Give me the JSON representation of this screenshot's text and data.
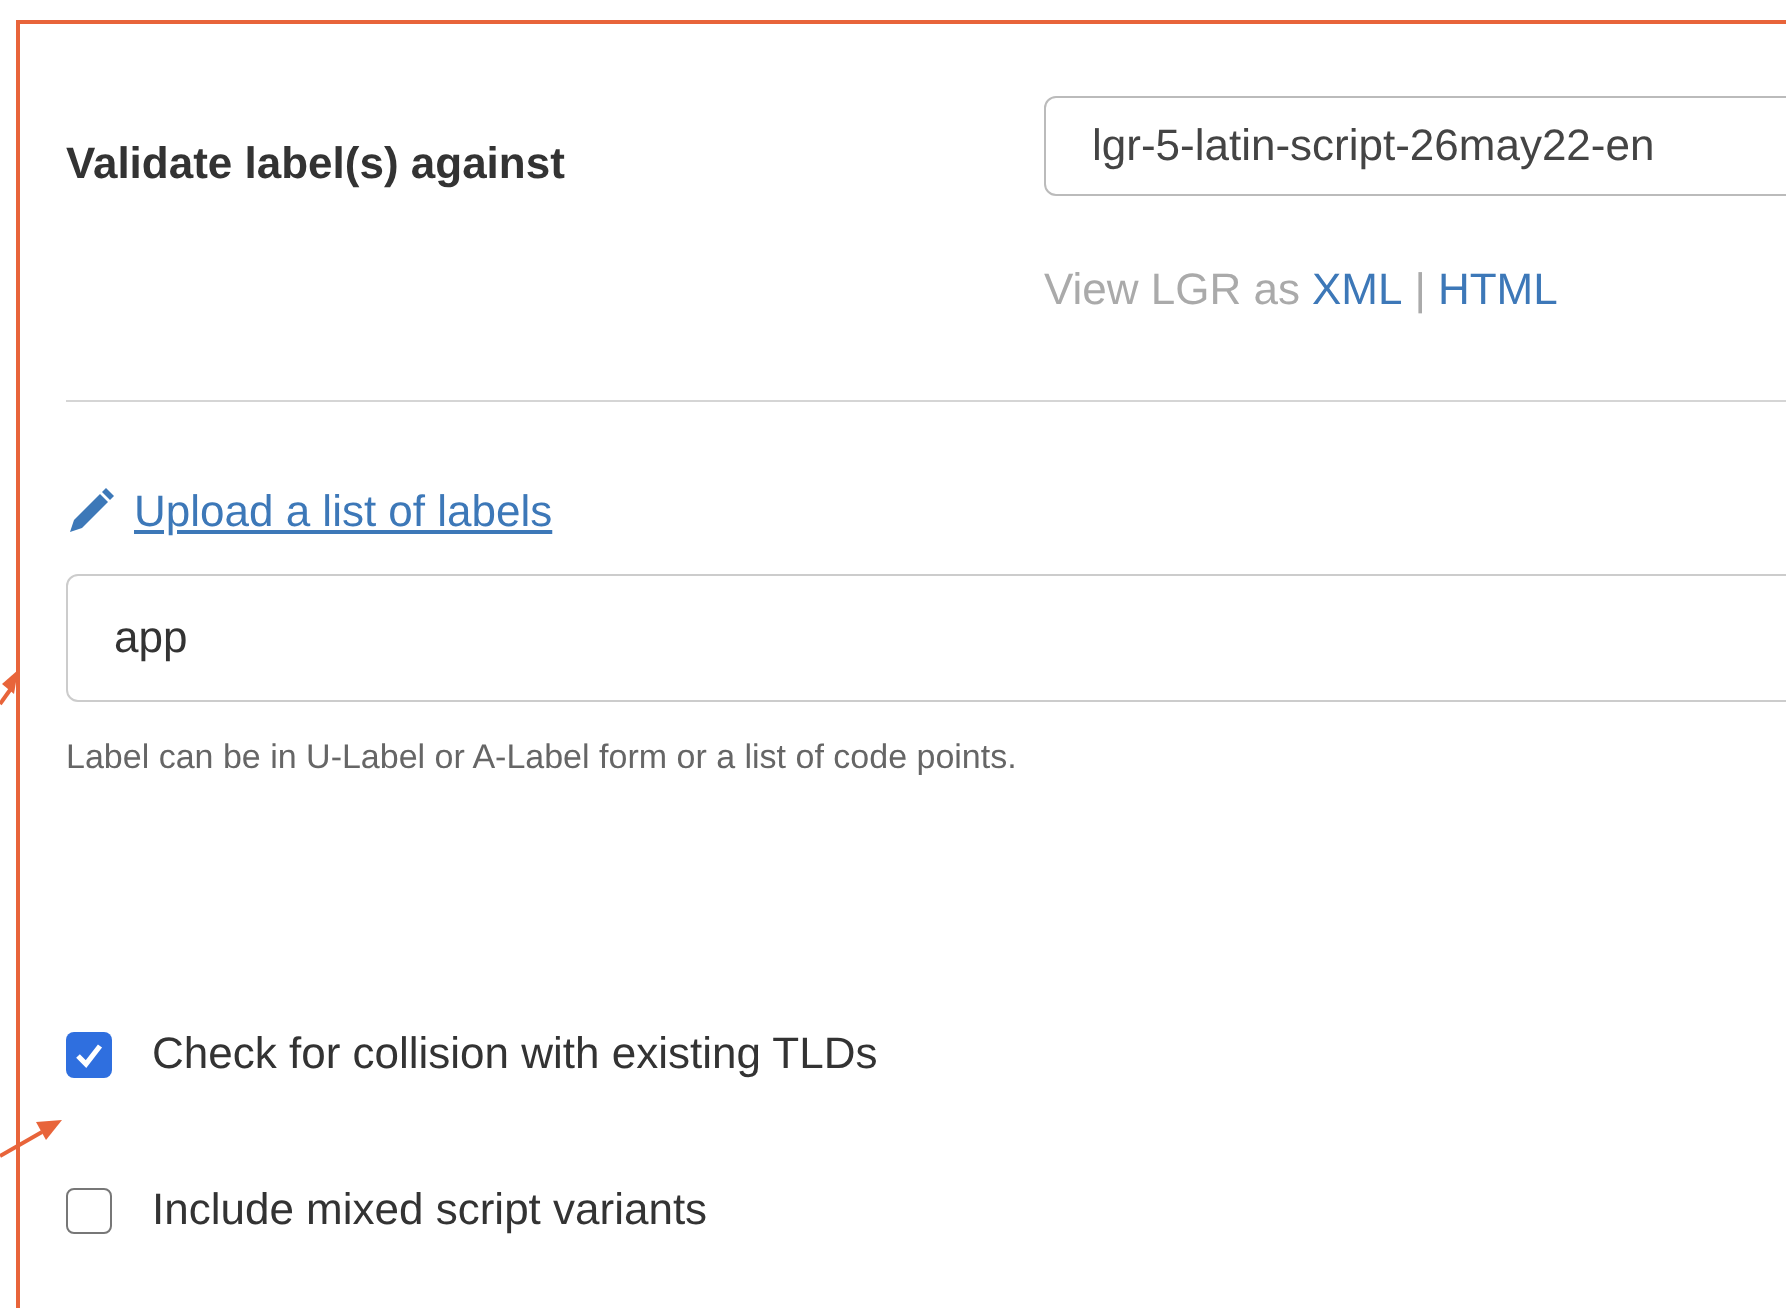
{
  "validate": {
    "label": "Validate label(s) against",
    "selected_lgr": "lgr-5-latin-script-26may22-en",
    "view_prefix": "View LGR as",
    "view_links": [
      "XML",
      "HTML"
    ],
    "view_separator": "|"
  },
  "upload": {
    "link": "Upload a list of labels"
  },
  "label_input": {
    "value": "app",
    "hint": "Label can be in U-Label or A-Label form or a list of code points."
  },
  "options": [
    {
      "label": "Check for collision with existing TLDs",
      "checked": true
    },
    {
      "label": "Include mixed script variants",
      "checked": false
    }
  ]
}
